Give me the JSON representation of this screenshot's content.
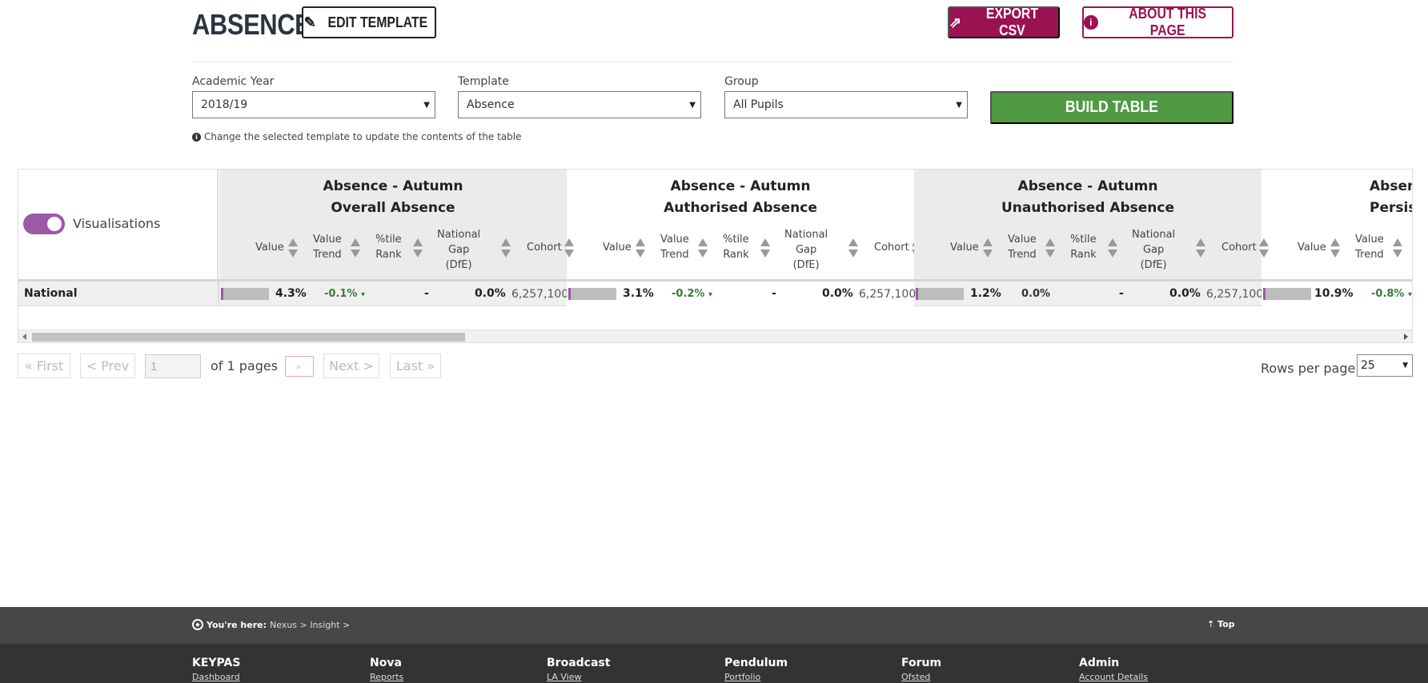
{
  "header": {
    "title": "ABSENCE",
    "edit_label": "EDIT TEMPLATE",
    "export_label": "EXPORT CSV",
    "about_label": "ABOUT THIS PAGE"
  },
  "filters": {
    "academic_year_label": "Academic Year",
    "academic_year_value": "2018/19",
    "template_label": "Template",
    "template_value": "Absence",
    "group_label": "Group",
    "group_value": "All Pupils",
    "build_label": "BUILD TABLE",
    "hint": "Change the selected template to update the contents of the table"
  },
  "table": {
    "visualisations_label": "Visualisations",
    "sub_headers": {
      "value": "Value",
      "value_trend_1": "Value",
      "value_trend_2": "Trend",
      "tile_1": "%tile",
      "tile_2": "Rank",
      "gap_1": "National",
      "gap_2": "Gap",
      "gap_3": "(DfE)",
      "cohort": "Cohort"
    },
    "groups": [
      {
        "title_1": "Absence - Autumn",
        "title_2": "Overall Absence"
      },
      {
        "title_1": "Absence - Autumn",
        "title_2": "Authorised Absence"
      },
      {
        "title_1": "Absence - Autumn",
        "title_2": "Unauthorised Absence"
      },
      {
        "title_1": "Absen",
        "title_2": "Persis"
      }
    ],
    "row": {
      "label": "National",
      "cells": [
        {
          "value": "4.3%",
          "trend": "-0.1%",
          "trend_arrow": "▾",
          "rank": "-",
          "gap": "0.0%",
          "cohort": "6,257,100"
        },
        {
          "value": "3.1%",
          "trend": "-0.2%",
          "trend_arrow": "▾",
          "rank": "-",
          "gap": "0.0%",
          "cohort": "6,257,100"
        },
        {
          "value": "1.2%",
          "trend": "0.0%",
          "trend_arrow": "",
          "rank": "-",
          "gap": "0.0%",
          "cohort": "6,257,100"
        },
        {
          "value": "10.9%",
          "trend": "-0.8%",
          "trend_arrow": "▾",
          "rank": "",
          "gap": "",
          "cohort": ""
        }
      ]
    }
  },
  "pagination": {
    "first": "« First",
    "prev": "< Prev",
    "page_value": "1",
    "of_pages": "of 1 pages",
    "go": "▸",
    "next": "Next >",
    "last": "Last »",
    "rows_label": "Rows per page",
    "rows_value": "25"
  },
  "footer": {
    "you_are_here": "You're here:",
    "path": "Nexus > Insight >",
    "top": "⇡ Top",
    "columns": [
      {
        "heading": "KEYPAS",
        "link": "Dashboard"
      },
      {
        "heading": "Nova",
        "link": "Reports"
      },
      {
        "heading": "Broadcast",
        "link": "LA View"
      },
      {
        "heading": "Pendulum",
        "link": "Portfolio"
      },
      {
        "heading": "Forum",
        "link": "Ofsted"
      },
      {
        "heading": "Admin",
        "link": "Account Details"
      }
    ]
  },
  "colors": {
    "brand": "#9b1253",
    "build": "#4f9a43",
    "toggle": "#9b59a6",
    "trend_negative": "#3c7a3a"
  }
}
